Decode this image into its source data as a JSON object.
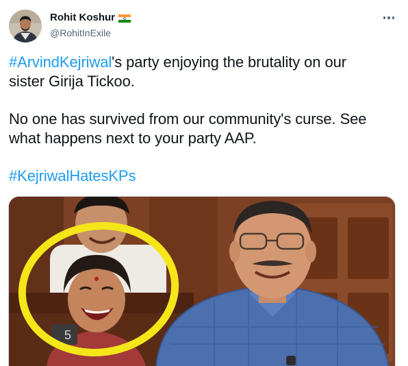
{
  "author": {
    "display_name": "Rohit Koshur",
    "handle": "@RohitInExile",
    "flag_icon": "india-flag-icon"
  },
  "tweet": {
    "line1_hashtag": "#ArvindKejriwal",
    "line1_rest": "'s party enjoying the brutality on our",
    "line2": "sister Girija Tickoo.",
    "line3": "No one has survived from our community's curse. See",
    "line4": "what happens next to your party AAP.",
    "hashtag2": "#KejriwalHatesKPs"
  },
  "media": {
    "seat_number": "5",
    "highlight_color": "#f5e61a"
  },
  "colors": {
    "link": "#1d9bf0",
    "text": "#0f1419",
    "secondary": "#536471"
  }
}
